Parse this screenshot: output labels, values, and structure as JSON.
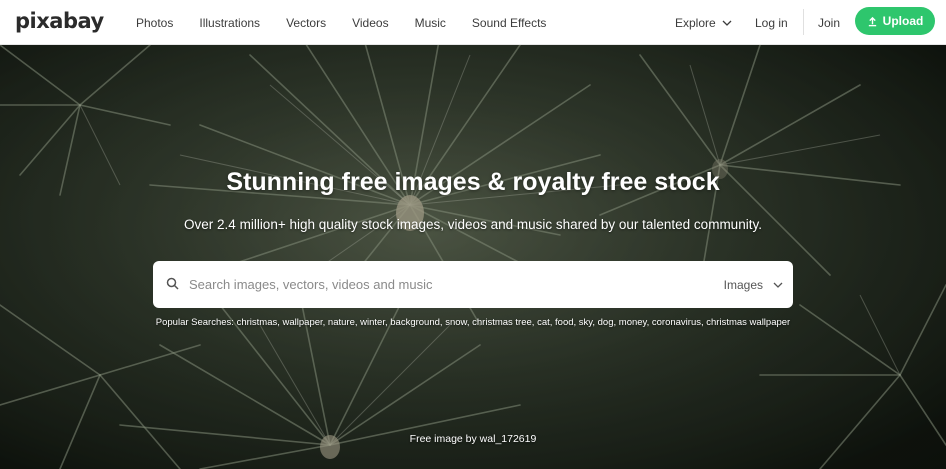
{
  "header": {
    "logo": "pixabay",
    "nav": [
      "Photos",
      "Illustrations",
      "Vectors",
      "Videos",
      "Music",
      "Sound Effects"
    ],
    "explore": "Explore",
    "login": "Log in",
    "join": "Join",
    "upload": "Upload"
  },
  "hero": {
    "headline": "Stunning free images & royalty free stock",
    "subline": "Over 2.4 million+ high quality stock images, videos and music shared by our talented community.",
    "search_placeholder": "Search images, vectors, videos and music",
    "search_type": "Images",
    "popular_label": "Popular Searches:",
    "popular_tags": [
      "christmas",
      "wallpaper",
      "nature",
      "winter",
      "background",
      "snow",
      "christmas tree",
      "cat",
      "food",
      "sky",
      "dog",
      "money",
      "coronavirus",
      "christmas wallpaper"
    ],
    "credit": "Free image by wal_172619"
  },
  "colors": {
    "accent": "#2ec66d",
    "header_bg": "#ffffff",
    "text": "#3c3c3c"
  },
  "icons": {
    "upload": "upload-icon",
    "search": "search-icon",
    "chevron": "chevron-down-icon"
  }
}
